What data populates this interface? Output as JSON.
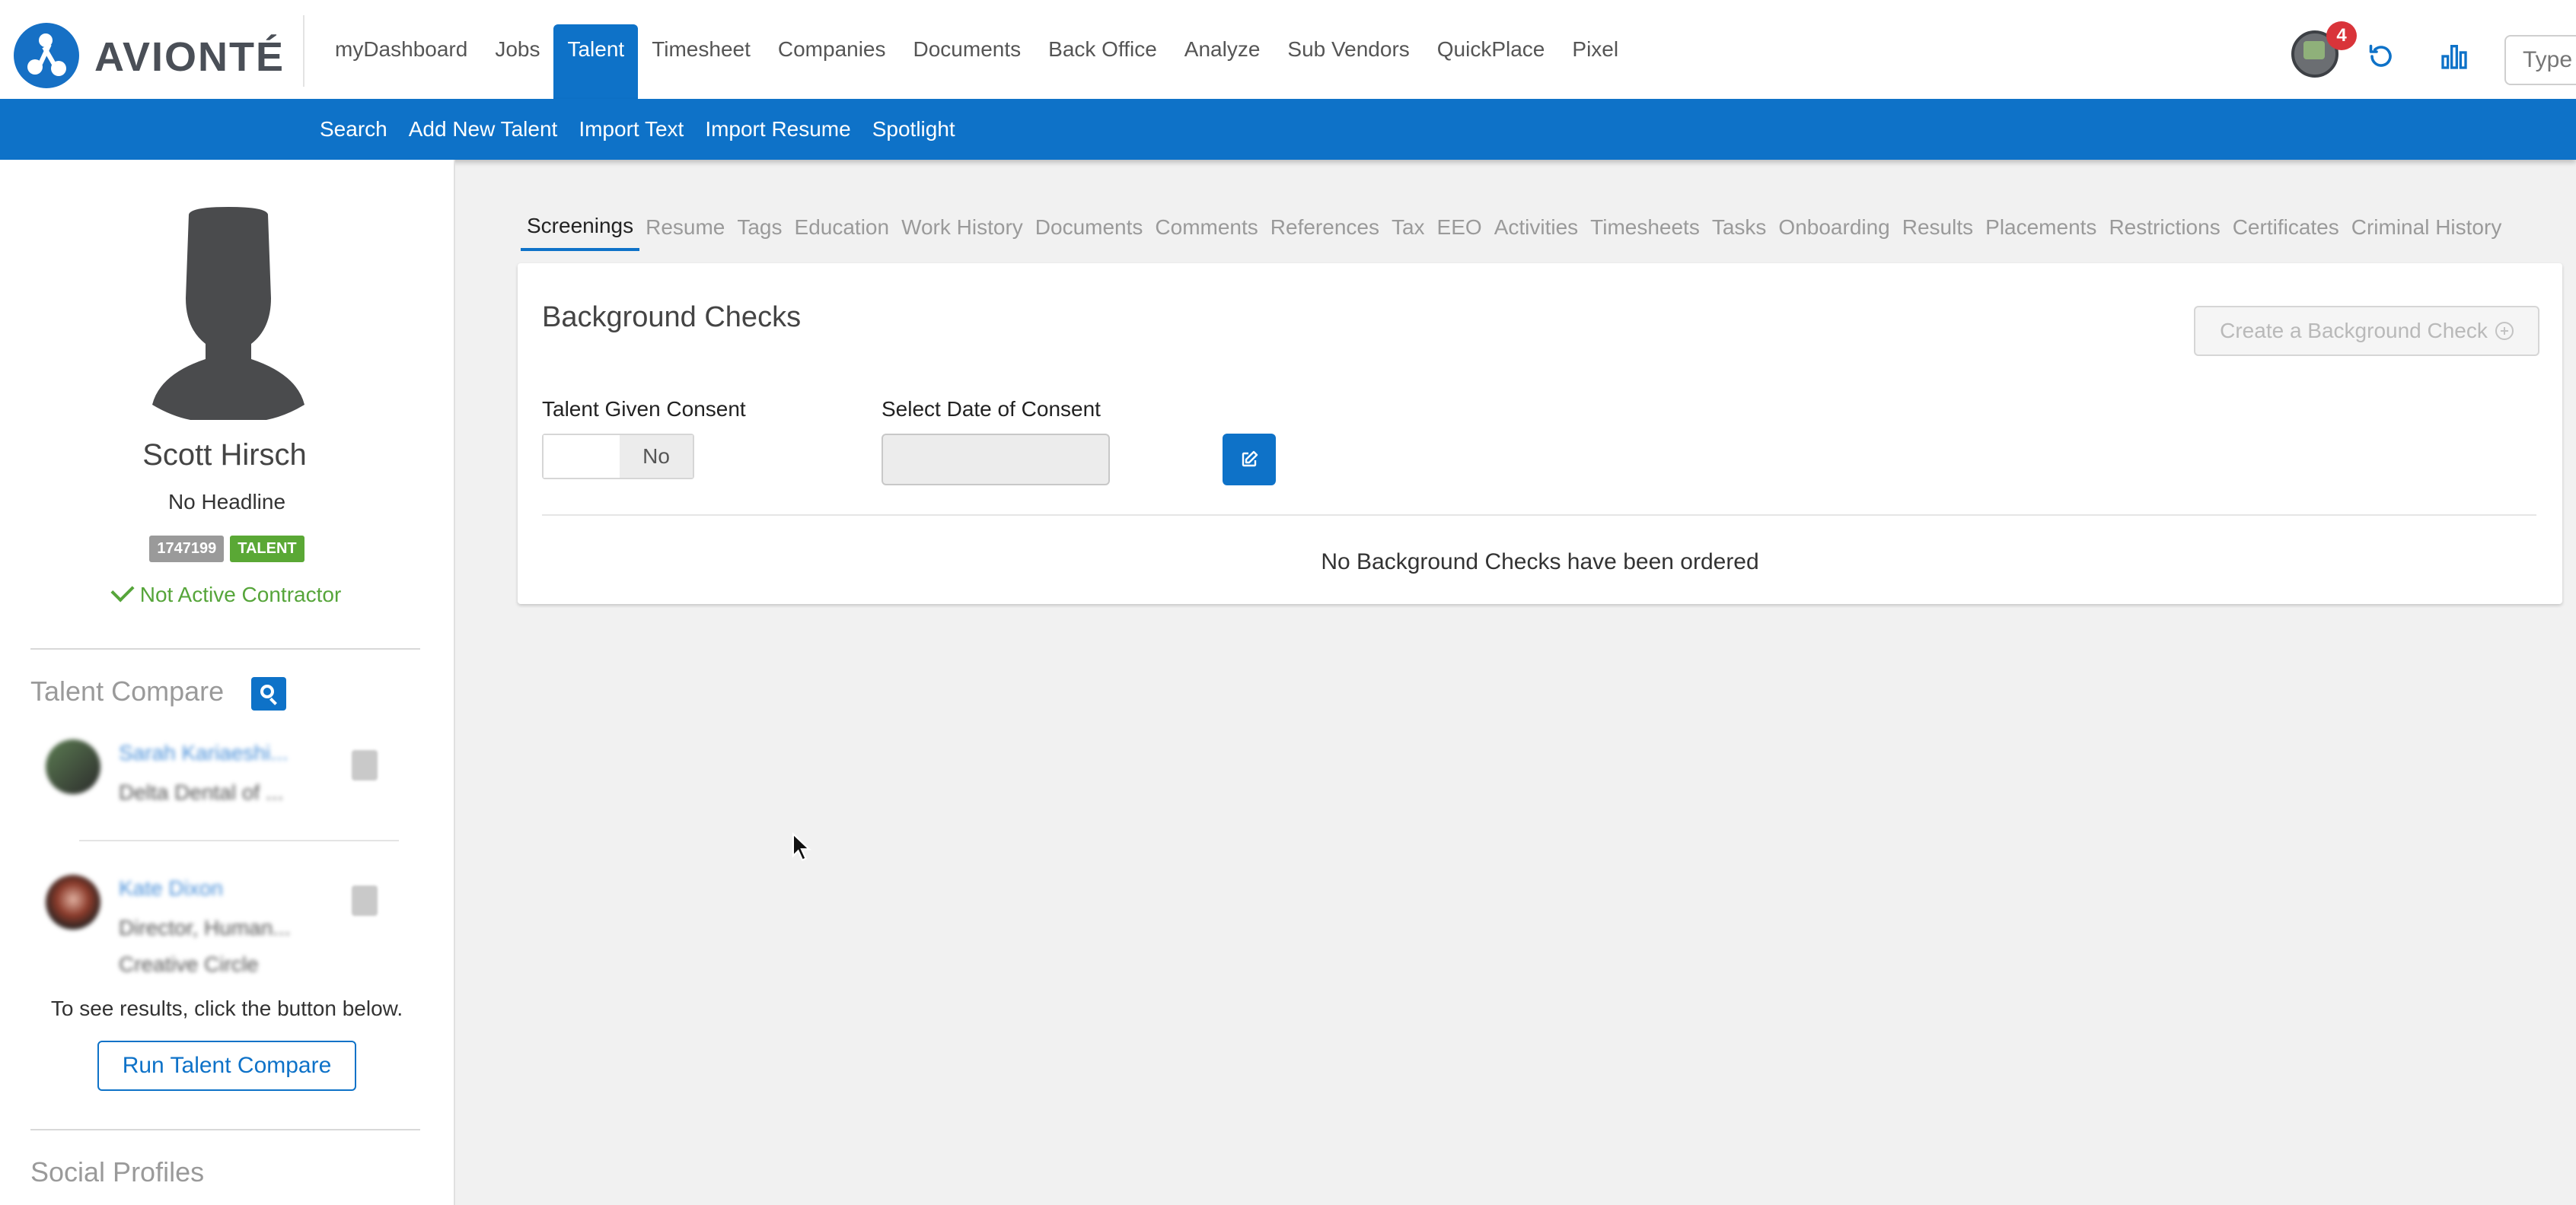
{
  "brand": {
    "name": "AVIONTÉ"
  },
  "nav": {
    "items": [
      {
        "label": "myDashboard"
      },
      {
        "label": "Jobs"
      },
      {
        "label": "Talent",
        "active": true
      },
      {
        "label": "Timesheet"
      },
      {
        "label": "Companies"
      },
      {
        "label": "Documents"
      },
      {
        "label": "Back Office"
      },
      {
        "label": "Analyze"
      },
      {
        "label": "Sub Vendors"
      },
      {
        "label": "QuickPlace"
      },
      {
        "label": "Pixel"
      }
    ],
    "notification_count": "4",
    "search_placeholder": "Type"
  },
  "subnav": {
    "items": [
      {
        "label": "Search"
      },
      {
        "label": "Add New Talent"
      },
      {
        "label": "Import Text"
      },
      {
        "label": "Import Resume"
      },
      {
        "label": "Spotlight"
      }
    ]
  },
  "profile": {
    "name": "Scott Hirsch",
    "headline": "No Headline",
    "id_badge": "1747199",
    "type_badge": "TALENT",
    "status": "Not Active Contractor"
  },
  "talent_compare": {
    "title": "Talent Compare",
    "results": [
      {
        "name": "Sarah Kariaeshi...",
        "line1": "Delta Dental of ...",
        "line2": ""
      },
      {
        "name": "Kate Dixon",
        "line1": "Director, Human...",
        "line2": "Creative Circle"
      }
    ],
    "hint": "To see results, click the button below.",
    "run_button": "Run Talent Compare"
  },
  "social_profiles": {
    "title": "Social Profiles"
  },
  "tabs": [
    {
      "label": "Screenings",
      "active": true
    },
    {
      "label": "Resume"
    },
    {
      "label": "Tags"
    },
    {
      "label": "Education"
    },
    {
      "label": "Work History"
    },
    {
      "label": "Documents"
    },
    {
      "label": "Comments"
    },
    {
      "label": "References"
    },
    {
      "label": "Tax"
    },
    {
      "label": "EEO"
    },
    {
      "label": "Activities"
    },
    {
      "label": "Timesheets"
    },
    {
      "label": "Tasks"
    },
    {
      "label": "Onboarding"
    },
    {
      "label": "Results"
    },
    {
      "label": "Placements"
    },
    {
      "label": "Restrictions"
    },
    {
      "label": "Certificates"
    },
    {
      "label": "Criminal History"
    }
  ],
  "background_checks": {
    "title": "Background Checks",
    "create_button": "Create a Background Check",
    "consent_label": "Talent Given Consent",
    "consent_value": "No",
    "date_label": "Select Date of Consent",
    "date_value": "",
    "empty_message": "No Background Checks have been ordered"
  },
  "colors": {
    "primary": "#0e72c8",
    "success": "#56a53a",
    "alert": "#d9343a"
  }
}
